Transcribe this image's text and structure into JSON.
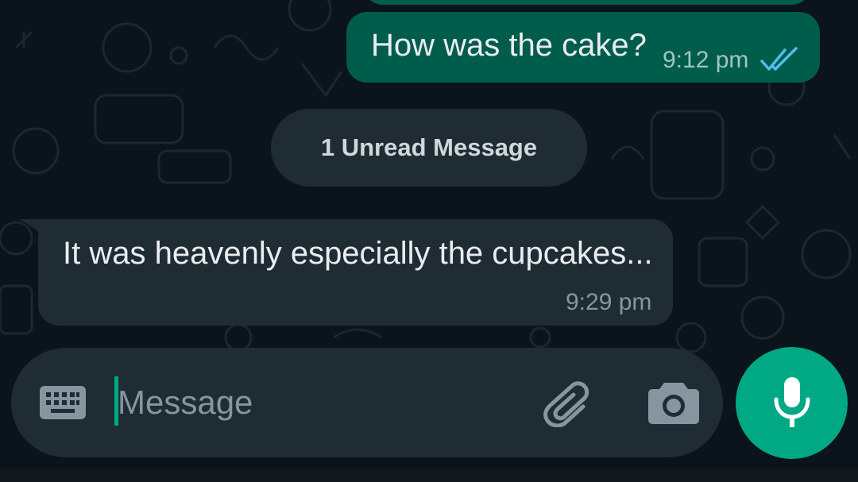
{
  "colors": {
    "background": "#0b141a",
    "outgoing_bubble": "#005c4b",
    "incoming_bubble": "#1f2c34",
    "accent": "#00a884",
    "read_ticks": "#53bdeb"
  },
  "conversation": {
    "outgoing": {
      "text": "How was the cake?",
      "time": "9:12 pm",
      "status_icon": "double-check-read-icon"
    },
    "unread_divider": "1 Unread Message",
    "incoming": {
      "text": "It was heavenly especially the cupcakes...",
      "time": "9:29 pm"
    }
  },
  "composer": {
    "placeholder": "Message",
    "keyboard_icon": "keyboard-icon",
    "attach_icon": "paperclip-icon",
    "camera_icon": "camera-icon",
    "mic_icon": "microphone-icon"
  }
}
